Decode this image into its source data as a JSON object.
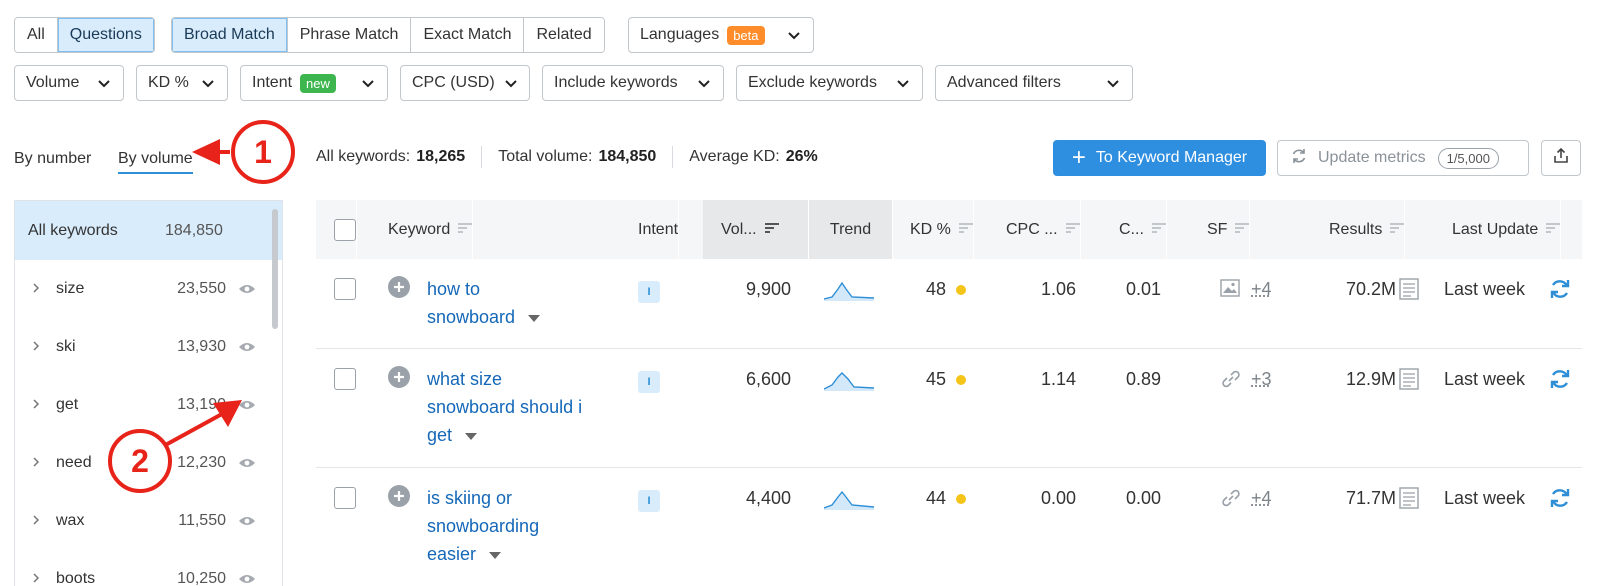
{
  "match_tabs": {
    "all": "All",
    "questions": "Questions",
    "broad": "Broad Match",
    "phrase": "Phrase Match",
    "exact": "Exact Match",
    "related": "Related"
  },
  "languages": {
    "label": "Languages",
    "badge": "beta"
  },
  "filters": {
    "volume": "Volume",
    "kd": "KD %",
    "intent": "Intent",
    "intent_badge": "new",
    "cpc": "CPC (USD)",
    "include": "Include keywords",
    "exclude": "Exclude keywords",
    "advanced": "Advanced filters"
  },
  "view_tabs": {
    "by_number": "By number",
    "by_volume": "By volume"
  },
  "annotations": {
    "one": "1",
    "two": "2"
  },
  "stats": {
    "all_keywords_label": "All keywords:",
    "all_keywords_value": "18,265",
    "total_volume_label": "Total volume:",
    "total_volume_value": "184,850",
    "avg_kd_label": "Average KD:",
    "avg_kd_value": "26%"
  },
  "actions": {
    "to_manager": "To Keyword Manager",
    "update_metrics": "Update metrics",
    "quota": "1/5,000"
  },
  "sidebar": {
    "all_label": "All keywords",
    "all_count": "184,850",
    "groups": [
      {
        "keyword": "size",
        "count": "23,550"
      },
      {
        "keyword": "ski",
        "count": "13,930"
      },
      {
        "keyword": "get",
        "count": "13,190"
      },
      {
        "keyword": "need",
        "count": "12,230"
      },
      {
        "keyword": "wax",
        "count": "11,550"
      },
      {
        "keyword": "boots",
        "count": "10,250"
      }
    ]
  },
  "table": {
    "headers": {
      "keyword": "Keyword",
      "intent": "Intent",
      "volume": "Vol...",
      "trend": "Trend",
      "kd": "KD %",
      "cpc": "CPC ...",
      "com": "C...",
      "sf": "SF",
      "results": "Results",
      "last_update": "Last Update"
    },
    "rows": [
      {
        "kw1": "how to",
        "kw2": "snowboard",
        "kw3": "",
        "intent": "I",
        "volume": "9,900",
        "kd": "48",
        "cpc": "1.06",
        "com": "0.01",
        "sf_icon": "image-icon",
        "sf_more": "+4",
        "results": "70.2M",
        "last_update": "Last week"
      },
      {
        "kw1": "what size",
        "kw2": "snowboard should i",
        "kw3": "get",
        "intent": "I",
        "volume": "6,600",
        "kd": "45",
        "cpc": "1.14",
        "com": "0.89",
        "sf_icon": "link-icon",
        "sf_more": "+3",
        "results": "12.9M",
        "last_update": "Last week"
      },
      {
        "kw1": "is skiing or",
        "kw2": "snowboarding",
        "kw3": "easier",
        "intent": "I",
        "volume": "4,400",
        "kd": "44",
        "cpc": "0.00",
        "com": "0.00",
        "sf_icon": "link-icon",
        "sf_more": "+4",
        "results": "71.7M",
        "last_update": "Last week"
      }
    ]
  },
  "colors": {
    "accent": "#2e8fe0",
    "annotation": "#e8231a",
    "kd_dot": "#f5c419",
    "link": "#1568b8"
  }
}
